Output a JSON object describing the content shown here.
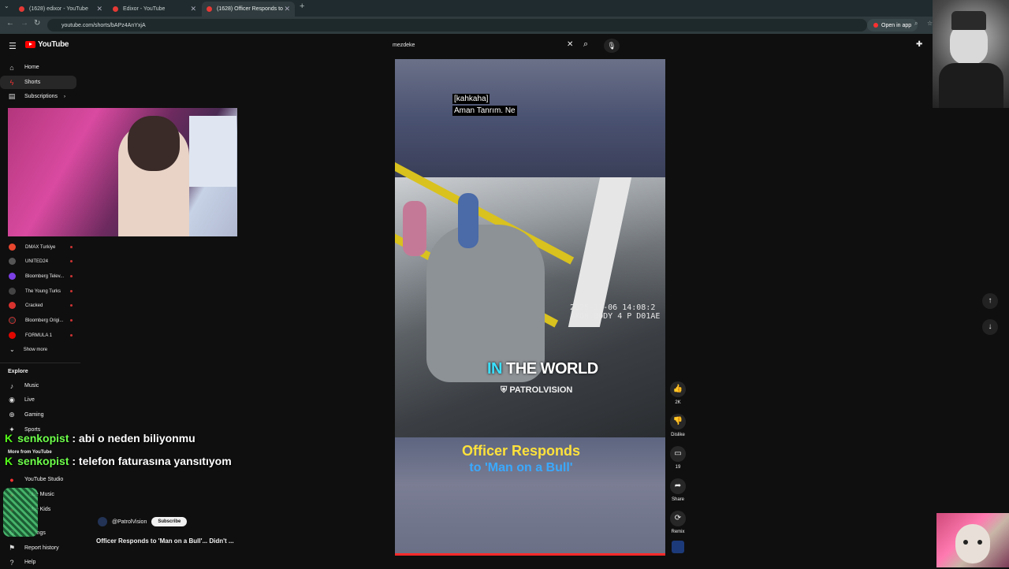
{
  "browser": {
    "tabs": [
      {
        "label": "(1628) edixor - YouTube"
      },
      {
        "label": "Edixor - YouTube"
      },
      {
        "label": "(1628) Officer Responds to"
      }
    ],
    "url": "youtube.com/shorts/bAPz4AnYxjA",
    "open_in_app": "Open in app"
  },
  "header": {
    "logo_text": "YouTube",
    "search_value": "mezdeke"
  },
  "sidebar": {
    "main": [
      {
        "label": "Home",
        "icon": "home-icon"
      },
      {
        "label": "Shorts",
        "icon": "shorts-icon"
      },
      {
        "label": "Subscriptions",
        "icon": "subscriptions-icon"
      }
    ],
    "subscriptions": [
      {
        "name": "DMAX Turkiye",
        "color": "#e8472e"
      },
      {
        "name": "UNITED24",
        "color": "#333333"
      },
      {
        "name": "Bloomberg Telev...",
        "color": "#7b3fe4"
      },
      {
        "name": "The Young Turks",
        "color": "#222222"
      },
      {
        "name": "Cracked",
        "color": "#d8322e"
      },
      {
        "name": "Bloomberg Origi...",
        "color": "#111111"
      },
      {
        "name": "FORMULA 1",
        "color": "#e10600"
      }
    ],
    "show_more": "Show more",
    "explore_title": "Explore",
    "explore": [
      {
        "label": "Music",
        "icon": "music-icon"
      },
      {
        "label": "Live",
        "icon": "live-icon"
      },
      {
        "label": "Gaming",
        "icon": "gaming-icon"
      },
      {
        "label": "Sports",
        "icon": "sports-icon"
      }
    ],
    "more_title": "More from YouTube",
    "more": [
      {
        "label": "YouTube Studio"
      },
      {
        "label": "ube Music"
      },
      {
        "label": "ube Kids"
      }
    ],
    "bottom": [
      {
        "label": "ings"
      },
      {
        "label": "Report history"
      },
      {
        "label": "Help"
      }
    ]
  },
  "video": {
    "caption_line1": "[kahkaha]",
    "caption_line2": "Aman Tanrım.  Ne",
    "timestamp_line1": "2025-11-06 14:08:2",
    "timestamp_line2": "AXON BODY 4 P D01AE",
    "overlay_highlight": "IN",
    "overlay_rest": " THE WORLD",
    "watermark": "PATROLVISION",
    "title_yellow": "Officer Responds",
    "title_blue": "to 'Man on a Bull'",
    "progress": 1.0
  },
  "actions": {
    "like_count": "2K",
    "dislike_label": "Dislike",
    "comments_count": "19",
    "share_label": "Share",
    "remix_label": "Remix"
  },
  "channel": {
    "handle": "@PatrolVision",
    "subscribe": "Subscribe",
    "video_title": "Officer Responds to 'Man on a Bull'... Didn't ..."
  },
  "chat": [
    {
      "user": "senkopist",
      "message": ": abi o neden biliyonmu"
    },
    {
      "user": "senkopist",
      "message": ": telefon faturasına yansıtıyom"
    }
  ]
}
